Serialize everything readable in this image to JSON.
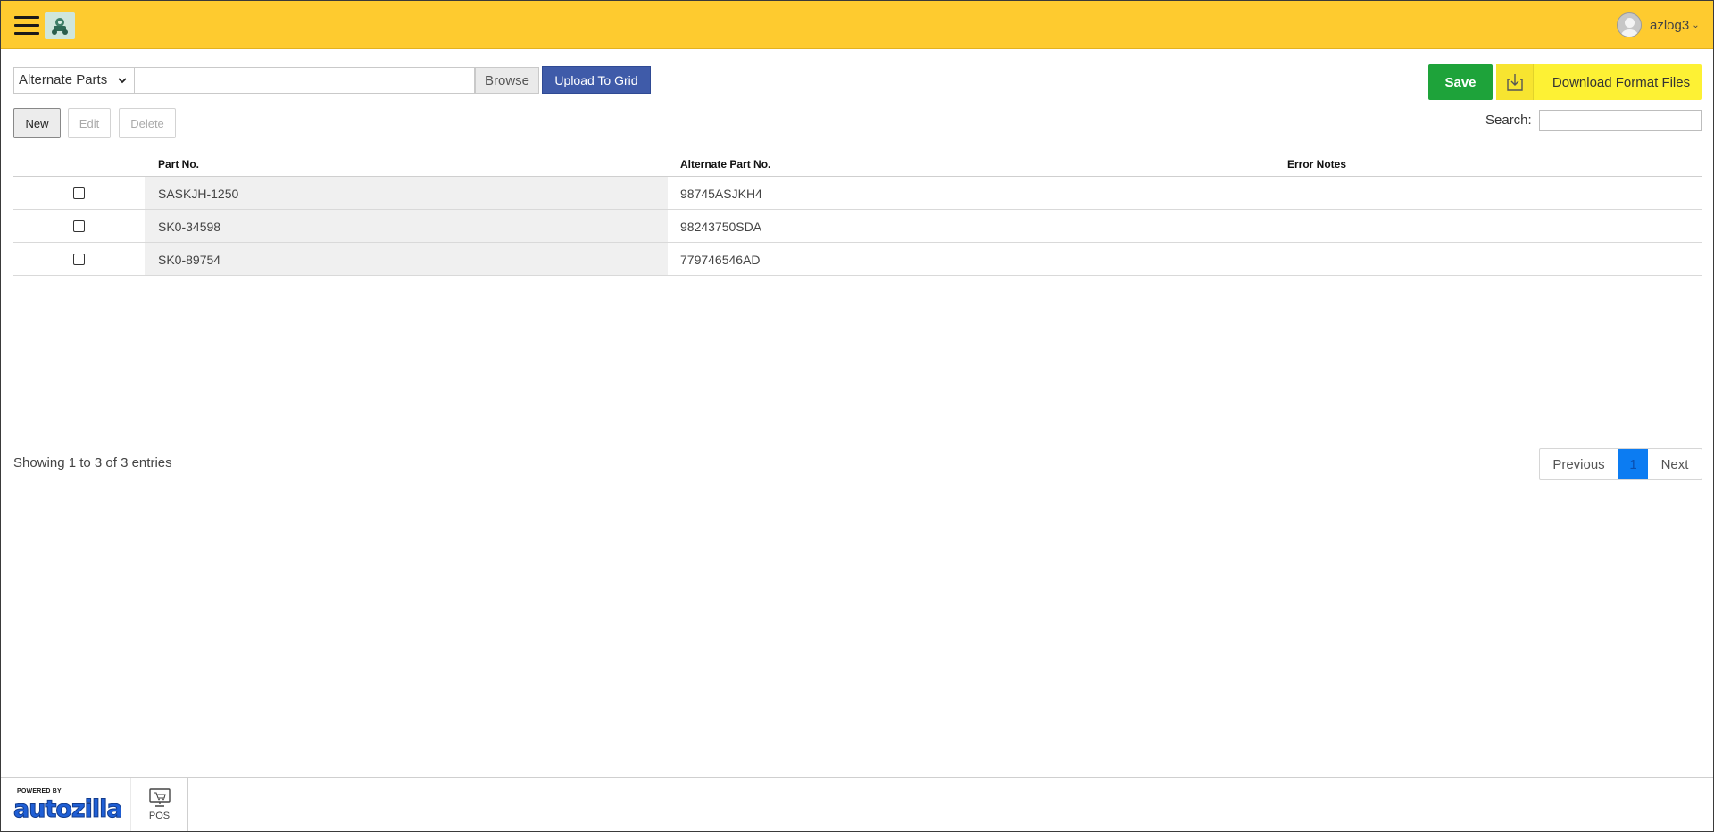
{
  "header": {
    "user_name": "azlog3",
    "icons": {
      "menu": "hamburger-menu-icon",
      "logo": "company-logo-icon",
      "avatar": "user-avatar-icon"
    }
  },
  "upload": {
    "type_selected": "Alternate Parts",
    "file_value": "",
    "browse_label": "Browse",
    "upload_label": "Upload To Grid"
  },
  "actions": {
    "save_label": "Save",
    "download_label": "Download Format Files"
  },
  "crud": {
    "new_label": "New",
    "edit_label": "Edit",
    "delete_label": "Delete"
  },
  "search": {
    "label": "Search:",
    "value": ""
  },
  "grid": {
    "columns": [
      "Part No.",
      "Alternate Part No.",
      "Error Notes"
    ],
    "rows": [
      {
        "part_no": "SASKJH-1250",
        "alt_part_no": "98745ASJKH4",
        "error_notes": ""
      },
      {
        "part_no": "SK0-34598",
        "alt_part_no": "98243750SDA",
        "error_notes": ""
      },
      {
        "part_no": "SK0-89754",
        "alt_part_no": "779746546AD",
        "error_notes": ""
      }
    ]
  },
  "pagination": {
    "info": "Showing 1 to 3 of 3 entries",
    "previous_label": "Previous",
    "current_page": "1",
    "next_label": "Next"
  },
  "footer": {
    "powered_by": "POWERED BY",
    "brand": "autozilla",
    "pos_label": "POS"
  },
  "colors": {
    "header_bg": "#fecb2f",
    "save_bg": "#1ea33a",
    "download_bg": "#fdf134",
    "upload_bg": "#3f5ba9",
    "active_page": "#0c7cf2"
  }
}
